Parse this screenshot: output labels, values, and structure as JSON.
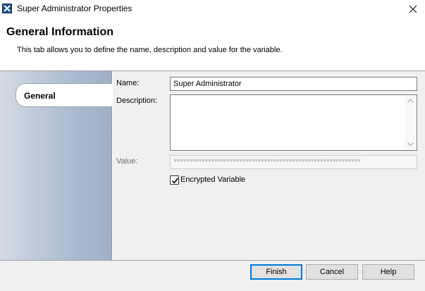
{
  "window": {
    "title": "Super Administrator Properties",
    "icon": "x-variable-icon"
  },
  "header": {
    "title": "General Information",
    "description": "This tab allows you to define the name, description and value for the variable."
  },
  "sidebar": {
    "tabs": [
      {
        "label": "General",
        "selected": true
      }
    ]
  },
  "form": {
    "name_label": "Name:",
    "name_value": "Super Administrator",
    "description_label": "Description:",
    "description_value": "",
    "value_label": "Value:",
    "value_masked": "************************************************************",
    "encrypted_label": "Encrypted Variable",
    "encrypted_checked": true
  },
  "footer": {
    "finish_label": "Finish",
    "cancel_label": "Cancel",
    "help_label": "Help"
  },
  "colors": {
    "accent": "#0078d7",
    "sidebar_gradient_start": "#d3dbe5",
    "sidebar_gradient_end": "#9fb0c6"
  }
}
